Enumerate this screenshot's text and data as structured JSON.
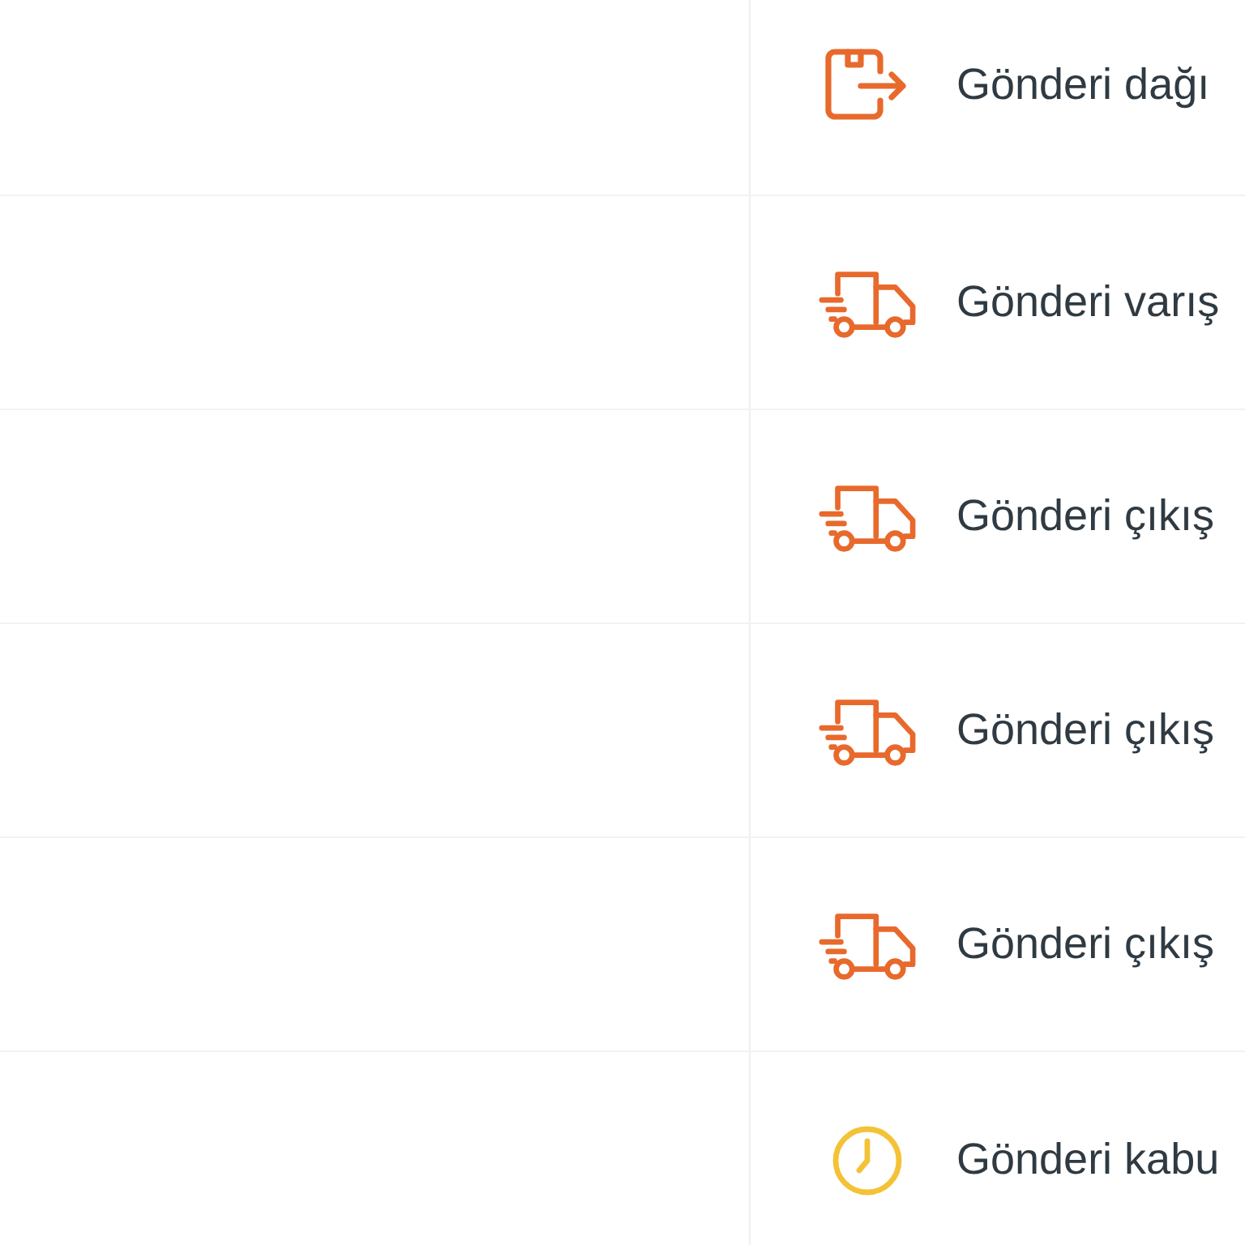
{
  "events": [
    {
      "kind": "box",
      "label": "Gönderi dağı"
    },
    {
      "kind": "truck",
      "label": "Gönderi varış"
    },
    {
      "kind": "truck",
      "label": "Gönderi çıkış"
    },
    {
      "kind": "truck",
      "label": "Gönderi çıkış"
    },
    {
      "kind": "truck",
      "label": "Gönderi çıkış"
    },
    {
      "kind": "clock",
      "label": "Gönderi kabu"
    }
  ]
}
